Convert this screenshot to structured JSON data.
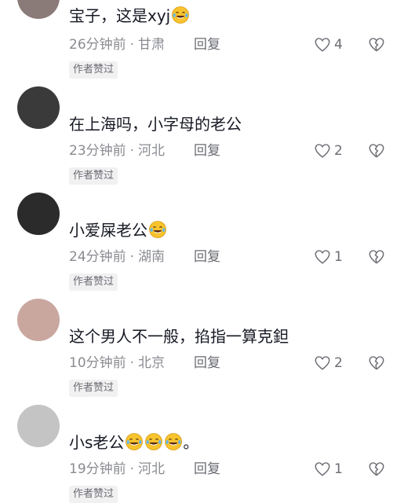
{
  "comments": [
    {
      "text": "宝子，这是xyj",
      "emoji_count": 1,
      "trailing": "",
      "time": "26分钟前",
      "location": "甘肃",
      "reply_label": "回复",
      "badge": "作者赞过",
      "likes": "4",
      "avatar_color": "#8a7a78"
    },
    {
      "text": "在上海吗，小字母的老公",
      "emoji_count": 0,
      "trailing": "",
      "time": "23分钟前",
      "location": "河北",
      "reply_label": "回复",
      "badge": "作者赞过",
      "likes": "2",
      "avatar_color": "#3a3a3a"
    },
    {
      "text": "小爱屎老公",
      "emoji_count": 1,
      "trailing": "",
      "time": "24分钟前",
      "location": "湖南",
      "reply_label": "回复",
      "badge": "作者赞过",
      "likes": "1",
      "avatar_color": "#2b2b2b"
    },
    {
      "text": "这个男人不一般，掐指一算克鉭",
      "emoji_count": 0,
      "trailing": "",
      "time": "10分钟前",
      "location": "北京",
      "reply_label": "回复",
      "badge": "作者赞过",
      "likes": "2",
      "avatar_color": "#c9a79f"
    },
    {
      "text": "小s老公",
      "emoji_count": 3,
      "trailing": "。",
      "time": "19分钟前",
      "location": "河北",
      "reply_label": "回复",
      "badge": "作者赞过",
      "likes": "1",
      "avatar_color": "#c4c4c4"
    }
  ],
  "icons": {
    "like": "heart-outline-icon",
    "dislike": "broken-heart-icon",
    "emoji": "laughing-crying-emoji-icon"
  },
  "colors": {
    "text": "#161823",
    "meta": "#8a8b91",
    "badge_bg": "#f1f1f2",
    "emoji_face": "#f7c32e"
  }
}
